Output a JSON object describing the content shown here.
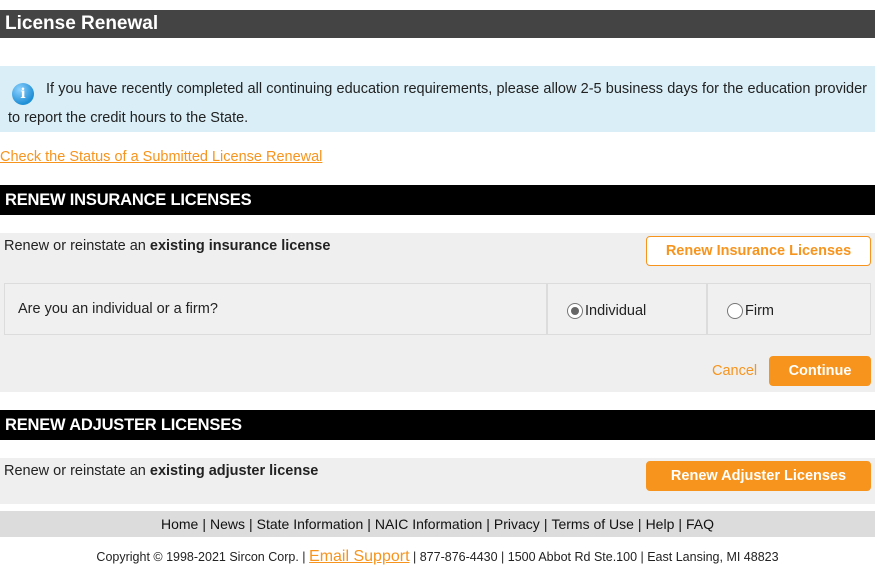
{
  "header": {
    "title": "License Renewal"
  },
  "info": {
    "icon": "info-icon",
    "text": "If you have recently completed all continuing education requirements, please allow 2-5 business days for the education provider to report the credit hours to the State."
  },
  "status_link": "Check the Status of a Submitted License Renewal",
  "insurance": {
    "header": "RENEW INSURANCE LICENSES",
    "desc_prefix": "Renew or reinstate an ",
    "desc_bold": "existing insurance license",
    "button": "Renew Insurance Licenses",
    "question": "Are you an individual or a firm?",
    "options": [
      "Individual",
      "Firm"
    ],
    "selected": "Individual",
    "cancel": "Cancel",
    "continue": "Continue"
  },
  "adjuster": {
    "header": "RENEW ADJUSTER LICENSES",
    "desc_prefix": "Renew or reinstate an ",
    "desc_bold": "existing adjuster license",
    "button": "Renew Adjuster Licenses"
  },
  "footer": {
    "links": [
      "Home",
      "News",
      "State Information",
      "NAIC Information",
      "Privacy",
      "Terms of Use",
      "Help",
      "FAQ"
    ],
    "copyright_prefix": "Copyright © 1998-2021 Sircon Corp. |",
    "email": "Email Support",
    "copyright_suffix": "| 877-876-4430 | 1500 Abbot Rd Ste.100 | East Lansing, MI 48823"
  },
  "colors": {
    "accent": "#f7941d",
    "info_bg": "#d9eef7",
    "title_bar": "#444444"
  }
}
